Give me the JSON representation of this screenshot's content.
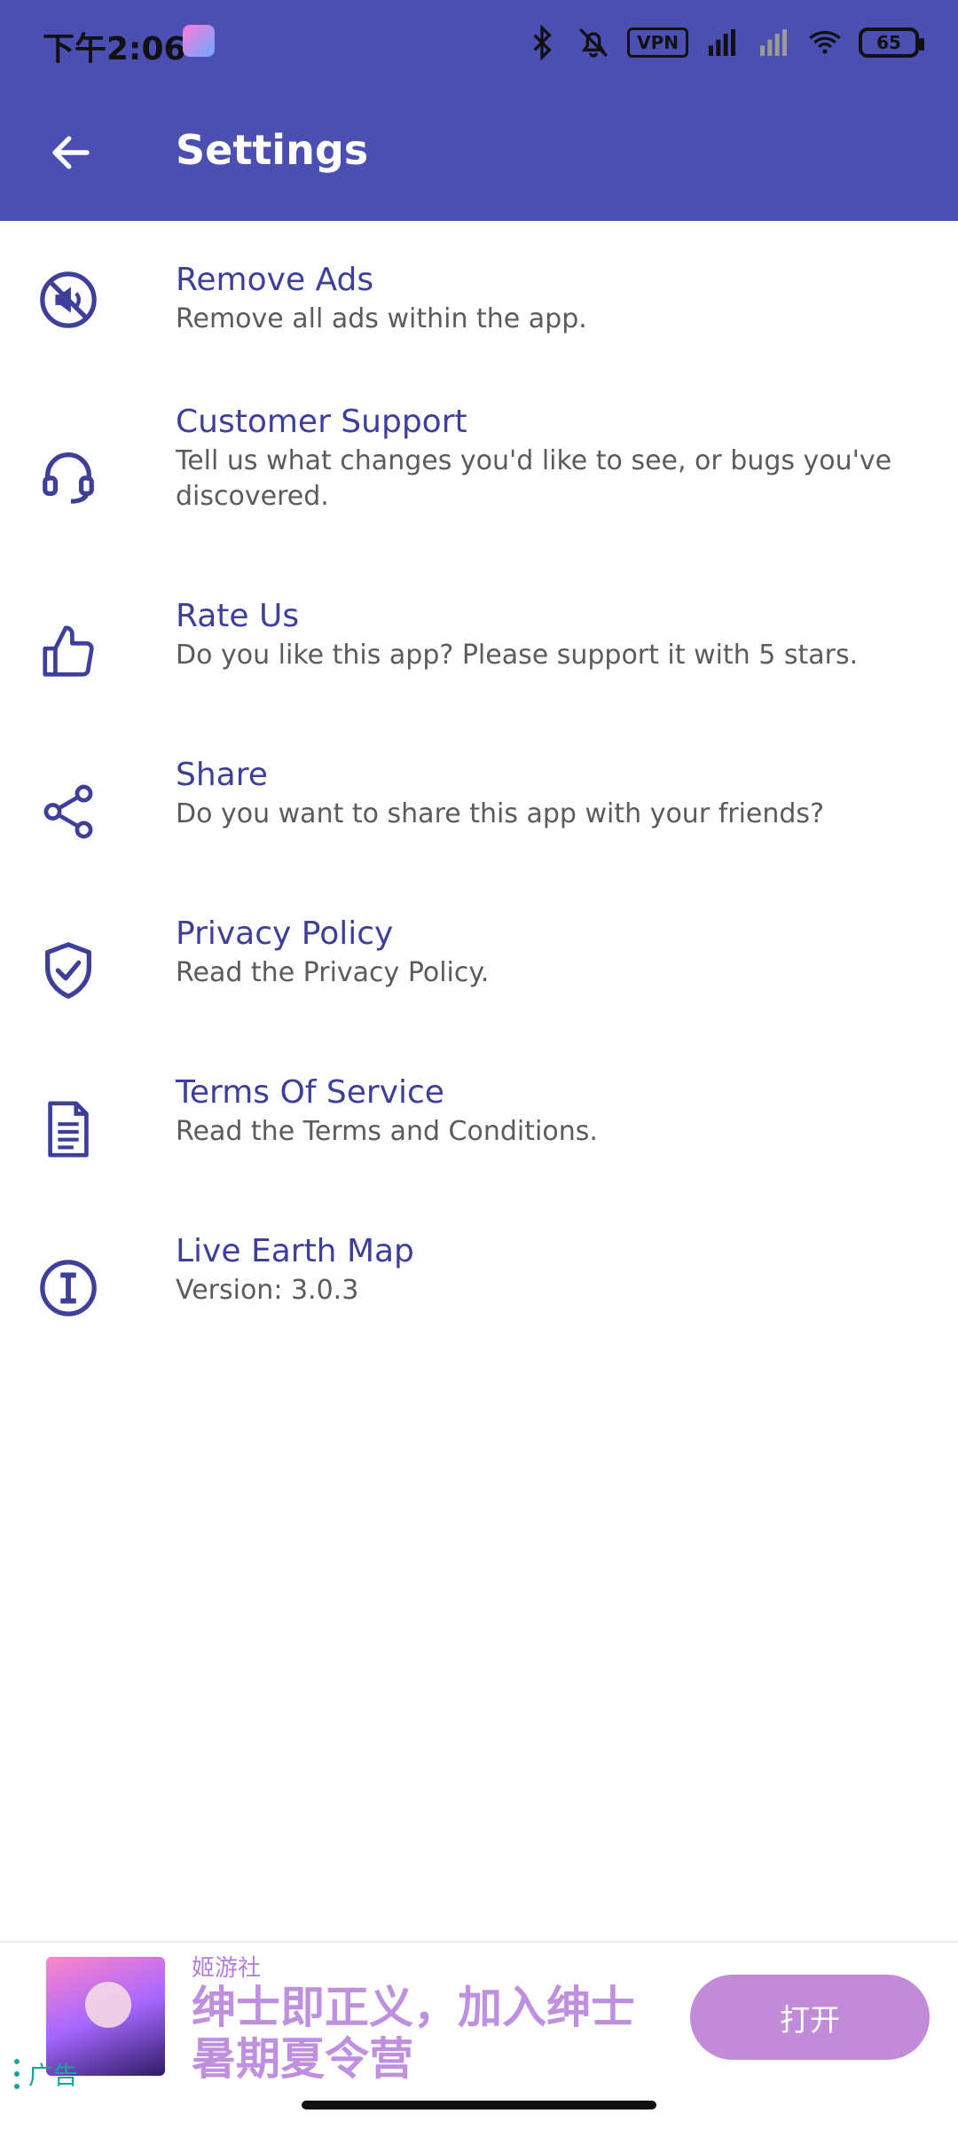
{
  "status_bar": {
    "time": "下午2:06",
    "vpn": "VPN",
    "battery": "65"
  },
  "app_bar": {
    "title": "Settings"
  },
  "colors": {
    "primary": "#4a4fb1",
    "title_text": "#3d3f9a",
    "ad_accent": "#c28bd9"
  },
  "settings": {
    "items": [
      {
        "icon": "no-ads-icon",
        "title": "Remove Ads",
        "desc": "Remove all ads within the app."
      },
      {
        "icon": "headset-icon",
        "title": "Customer Support",
        "desc": "Tell us what changes you'd like to see, or bugs you've discovered."
      },
      {
        "icon": "thumbs-up-icon",
        "title": "Rate Us",
        "desc": "Do you like this app? Please support it with 5 stars."
      },
      {
        "icon": "share-icon",
        "title": "Share",
        "desc": "Do you want to share this app with your friends?"
      },
      {
        "icon": "shield-check-icon",
        "title": "Privacy Policy",
        "desc": "Read the Privacy Policy."
      },
      {
        "icon": "document-icon",
        "title": "Terms Of Service",
        "desc": "Read the Terms and Conditions."
      },
      {
        "icon": "info-icon",
        "title": "Live Earth Map",
        "desc": "Version: 3.0.3"
      }
    ]
  },
  "ad": {
    "brand": "姬游社",
    "headline": "绅士即正义，加入绅士暑期夏令营",
    "cta": "打开",
    "label": "广告"
  }
}
